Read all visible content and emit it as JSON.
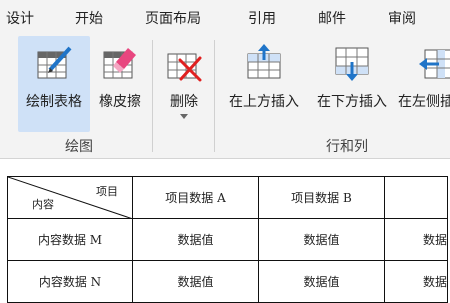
{
  "ribbon_tabs": [
    "设计",
    "开始",
    "页面布局",
    "引用",
    "邮件",
    "审阅"
  ],
  "draw_group": {
    "label": "绘图",
    "buttons": [
      {
        "label": "绘制表格",
        "icon": "draw-table-icon",
        "active": true
      },
      {
        "label": "橡皮擦",
        "icon": "eraser-icon",
        "active": false
      }
    ]
  },
  "delete_button": {
    "label": "删除",
    "icon": "delete-table-icon"
  },
  "rows_cols_group": {
    "label": "行和列",
    "buttons": [
      {
        "label": "在上方插入",
        "icon": "insert-above-icon"
      },
      {
        "label": "在下方插入",
        "icon": "insert-below-icon"
      },
      {
        "label": "在左侧插",
        "icon": "insert-left-icon"
      }
    ]
  },
  "table": {
    "corner_top": "项目",
    "corner_bottom": "内容",
    "headers": [
      "项目数据 A",
      "项目数据 B",
      ""
    ],
    "rows": [
      {
        "label": "内容数据 M",
        "cells": [
          "数据值",
          "数据值",
          "数据"
        ]
      },
      {
        "label": "内容数据 N",
        "cells": [
          "数据值",
          "数据值",
          "数据"
        ]
      }
    ]
  },
  "colors": {
    "ribbon_bg": "#f3f3f3",
    "active_bg": "#cfe1f7",
    "accent": "#1f74c8",
    "eraser": "#e8467f",
    "delete": "#e02020"
  }
}
